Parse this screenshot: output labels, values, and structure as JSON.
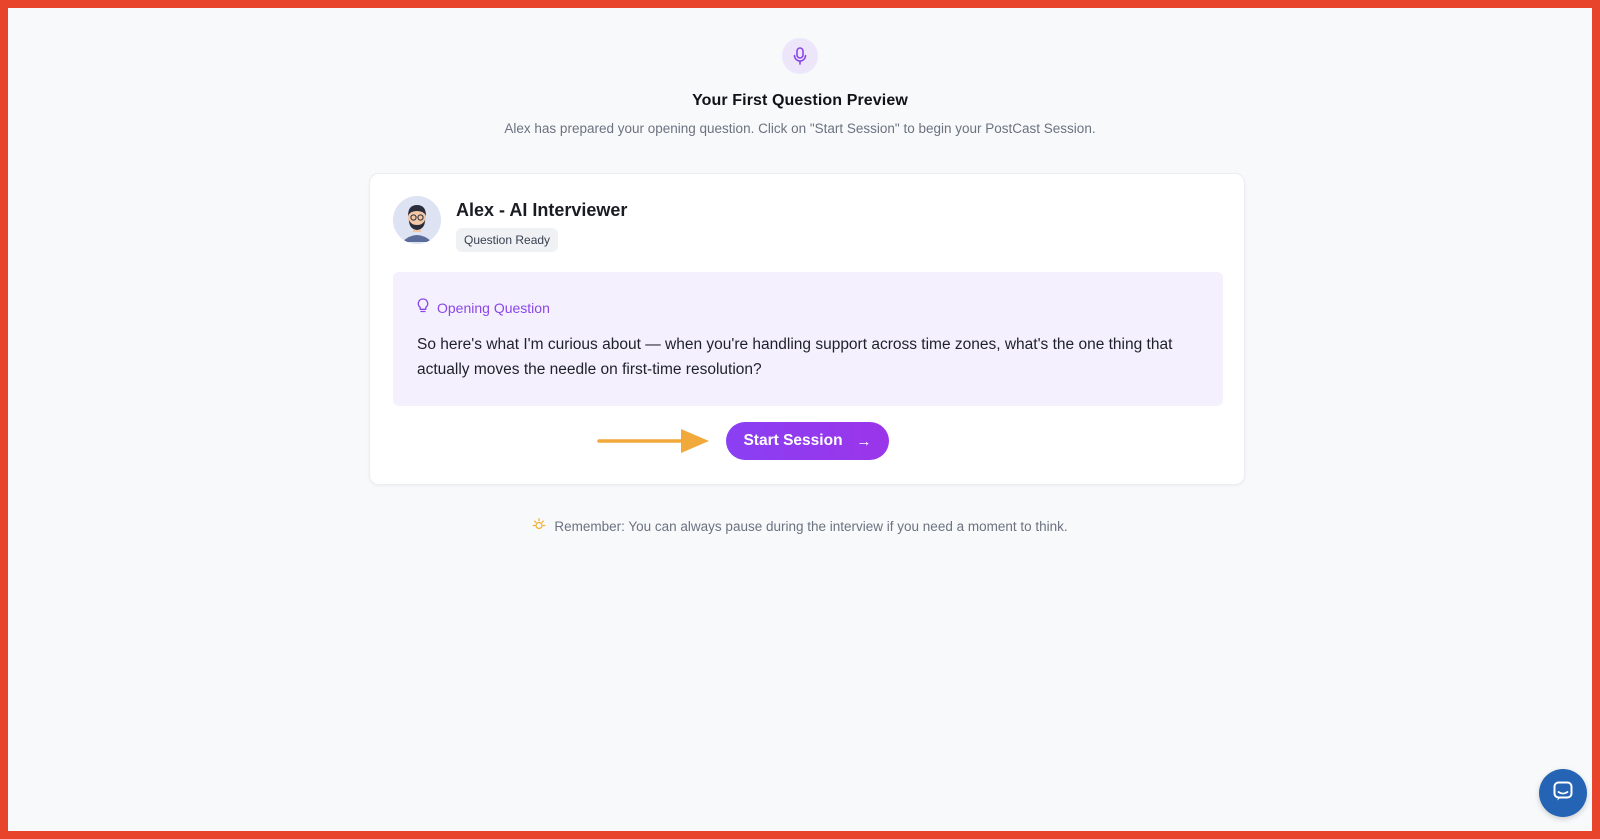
{
  "header": {
    "icon": "microphone-icon",
    "title": "Your First Question Preview",
    "subtitle": "Alex has prepared your opening question. Click on \"Start Session\" to begin your PostCast Session."
  },
  "interviewer": {
    "avatar": "avatar-illustration",
    "name": "Alex - AI Interviewer",
    "status": "Question Ready"
  },
  "question": {
    "icon": "lightbulb-icon",
    "label": "Opening Question",
    "text": "So here's what I'm curious about — when you're handling support across time zones, what's the one thing that actually moves the needle on first-time resolution?"
  },
  "action": {
    "start_label": "Start Session",
    "start_arrow": "→",
    "pointer": "arrow-right-icon"
  },
  "reminder": {
    "icon": "sun-icon",
    "text": "Remember: You can always pause during the interview if you need a moment to think."
  },
  "chat": {
    "icon": "chat-icon"
  },
  "colors": {
    "frame_border": "#e8442c",
    "accent": "#8b47e8",
    "arrow": "#f2a93b",
    "chat": "#2563b5"
  }
}
